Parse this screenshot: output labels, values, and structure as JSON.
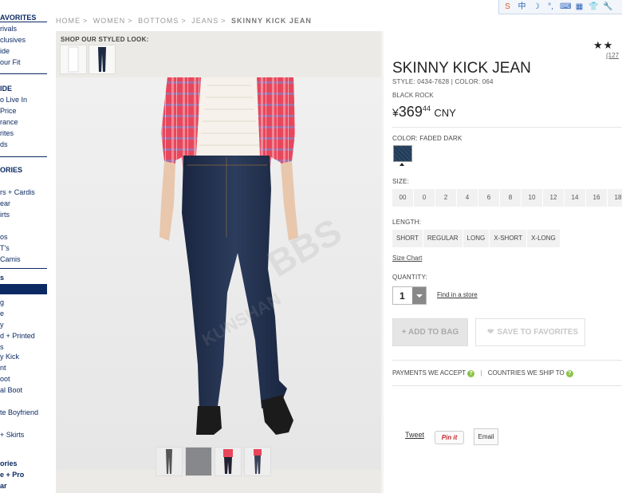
{
  "leftnav": {
    "lines": [
      {
        "text": "AVORITES",
        "type": "head"
      },
      {
        "text": "rivals",
        "type": "item"
      },
      {
        "text": "clusives",
        "type": "item"
      },
      {
        "text": "ide",
        "type": "item"
      },
      {
        "text": "our Fit",
        "type": "item"
      },
      {
        "text": "IDE",
        "type": "head"
      },
      {
        "text": "o Live In",
        "type": "item"
      },
      {
        "text": "Price",
        "type": "item"
      },
      {
        "text": "rance",
        "type": "item"
      },
      {
        "text": "rites",
        "type": "item"
      },
      {
        "text": "ds",
        "type": "item"
      },
      {
        "text": "ORIES",
        "type": "head"
      },
      {
        "text": "rs + Cardis",
        "type": "item"
      },
      {
        "text": "ear",
        "type": "item"
      },
      {
        "text": "irts",
        "type": "item"
      },
      {
        "text": "os",
        "type": "item"
      },
      {
        "text": "T's",
        "type": "item"
      },
      {
        "text": "Camis",
        "type": "item"
      },
      {
        "text": "s",
        "type": "head"
      },
      {
        "text": "",
        "type": "selected"
      },
      {
        "text": "g",
        "type": "item"
      },
      {
        "text": "e",
        "type": "item"
      },
      {
        "text": "y",
        "type": "item"
      },
      {
        "text": "d + Printed",
        "type": "item"
      },
      {
        "text": "s",
        "type": "item"
      },
      {
        "text": "y Kick",
        "type": "item"
      },
      {
        "text": "nt",
        "type": "item"
      },
      {
        "text": "oot",
        "type": "item"
      },
      {
        "text": "al Boot",
        "type": "item"
      },
      {
        "text": "te Boyfriend",
        "type": "item"
      },
      {
        "text": "+ Skirts",
        "type": "item"
      },
      {
        "text": "ories",
        "type": "head"
      },
      {
        "text": "e + Pro",
        "type": "head"
      },
      {
        "text": "ar",
        "type": "head"
      }
    ]
  },
  "breadcrumb": {
    "items": [
      "HOME",
      "WOMEN",
      "BOTTOMS",
      "JEANS"
    ],
    "current": "SKINNY KICK JEAN",
    "separator": ">"
  },
  "toolbar": {
    "icons": [
      "sogou-icon",
      "chinese-mode-icon",
      "moon-icon",
      "punctuation-icon",
      "keyboard-icon",
      "grid-icon",
      "shirt-icon",
      "wrench-icon"
    ],
    "glyphs": [
      "S",
      "中",
      "☽",
      "°,",
      "⌨",
      "▦",
      "👕",
      "🔧"
    ]
  },
  "styled_look": {
    "title": "SHOP OUR STYLED LOOK:"
  },
  "product": {
    "rating_stars": "★★",
    "reviews": "(127",
    "title": "SKINNY KICK JEAN",
    "style_label": "STYLE:",
    "style_no": "0434-7628",
    "color_label_inline": "COLOR:",
    "color_no": "064",
    "variant": "BLACK ROCK",
    "price_currency": "¥",
    "price_main": "369",
    "price_cents": "44",
    "price_code": "CNY"
  },
  "options": {
    "color_label": "COLOR: FADED DARK",
    "size_label": "SIZE:",
    "sizes": [
      "00",
      "0",
      "2",
      "4",
      "6",
      "8",
      "10",
      "12",
      "14",
      "16",
      "18"
    ],
    "length_label": "LENGTH:",
    "lengths": [
      "SHORT",
      "REGULAR",
      "LONG",
      "X-SHORT",
      "X-LONG"
    ],
    "size_chart": "Size Chart",
    "quantity_label": "QUANTITY:",
    "quantity": "1",
    "find_in_store": "Find in a store"
  },
  "actions": {
    "add_to_bag": "+ ADD TO BAG",
    "save_to_favorites": "SAVE TO FAVORITES"
  },
  "info": {
    "payments": "PAYMENTS WE ACCEPT",
    "countries": "COUNTRIES WE SHIP TO",
    "qmark": "?"
  },
  "social": {
    "tweet": "Tweet",
    "pin": "Pin it",
    "email": "Email"
  },
  "colors": {
    "navy": "#0b2a63",
    "swatch": "#233a55",
    "accent_green": "#8bc34a"
  }
}
